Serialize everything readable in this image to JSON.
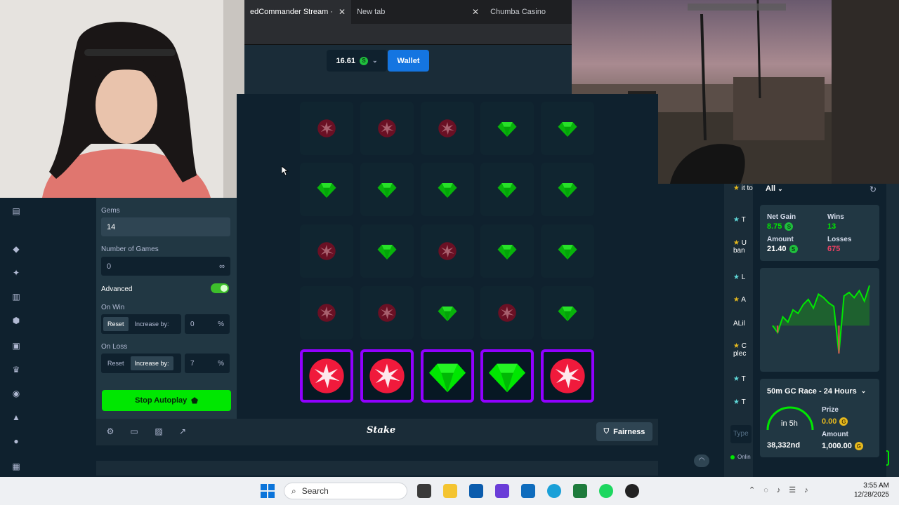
{
  "browser": {
    "tabs": [
      {
        "label": "edCommander Stream ·",
        "close": "✕",
        "active": true
      },
      {
        "label": "New tab",
        "close": "✕",
        "active": false
      },
      {
        "label": "Chumba Casino",
        "active": false
      }
    ]
  },
  "header": {
    "balance": "16.61",
    "balance_currency": "S",
    "wallet_label": "Wallet"
  },
  "controls": {
    "gems_label": "Gems",
    "gems_value": "14",
    "num_games_label": "Number of Games",
    "num_games_value": "0",
    "num_games_infinity": "∞",
    "advanced_label": "Advanced",
    "advanced_on": true,
    "on_win_label": "On Win",
    "on_win_reset": "Reset",
    "on_win_increase": "Increase by:",
    "on_win_value": "0",
    "on_win_unit": "%",
    "on_loss_label": "On Loss",
    "on_loss_reset": "Reset",
    "on_loss_increase": "Increase by:",
    "on_loss_value": "7",
    "on_loss_unit": "%",
    "stop_autoplay": "Stop Autoplay"
  },
  "board": {
    "rows": [
      [
        "mine",
        "mine",
        "mine",
        "gem",
        "gem"
      ],
      [
        "gem",
        "gem",
        "gem",
        "gem",
        "gem"
      ],
      [
        "mine",
        "gem",
        "mine",
        "gem",
        "gem"
      ],
      [
        "mine",
        "mine",
        "gem",
        "mine",
        "gem"
      ],
      [
        "mine",
        "mine",
        "gem",
        "gem",
        "mine"
      ]
    ],
    "revealed_row": 4
  },
  "footer": {
    "logo": "Stake",
    "fairness": "Fairness"
  },
  "stats": {
    "filter": "All",
    "net_gain_label": "Net Gain",
    "net_gain_value": "8.75",
    "wins_label": "Wins",
    "wins_value": "13",
    "amount_label": "Amount",
    "amount_value": "21.40",
    "losses_label": "Losses",
    "losses_value": "675",
    "chart_profit": [
      0,
      -0.4,
      0.5,
      0.2,
      0.9,
      0.7,
      1.2,
      1.5,
      1.0,
      1.8,
      1.6,
      1.3,
      1.1,
      -1.6,
      1.7,
      1.9,
      1.6,
      2.0,
      1.4,
      2.3
    ]
  },
  "race": {
    "title": "50m GC Race - 24 Hours",
    "countdown": "in 5h",
    "position": "38,332nd",
    "prize_label": "Prize",
    "prize_value": "0.00",
    "amount_label": "Amount",
    "amount_value": "1,000.00"
  },
  "chat": {
    "items": [
      "it to",
      "T",
      "U",
      "ban",
      "L",
      "A",
      "ALil",
      "C",
      "plec",
      "T",
      "T"
    ],
    "input_placeholder": "Type",
    "online": "Onlin"
  },
  "taskbar": {
    "search_placeholder": "Search",
    "time": "3:55 AM",
    "date": "12/28/2025"
  },
  "colors": {
    "accent_green": "#00e701",
    "revealed_border": "#9000ff",
    "wallet_blue": "#1475e1",
    "bg": "#0f212e"
  }
}
